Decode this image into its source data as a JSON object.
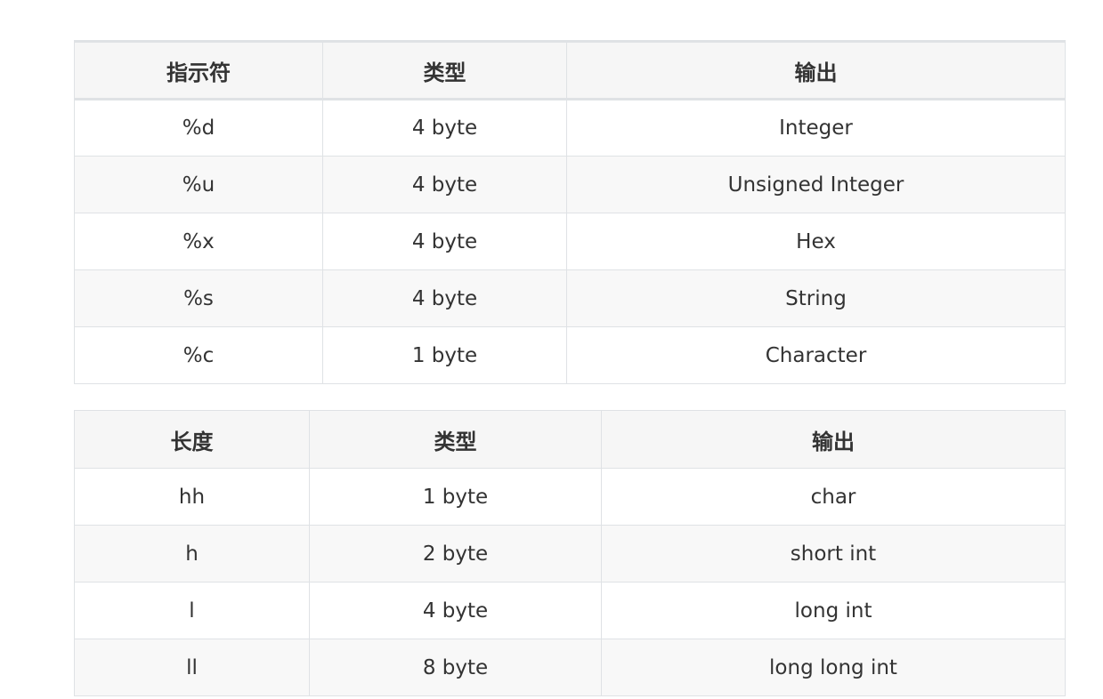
{
  "format_table": {
    "headers": [
      "指示符",
      "类型",
      "输出"
    ],
    "rows": [
      [
        "%d",
        "4 byte",
        "Integer"
      ],
      [
        "%u",
        "4 byte",
        "Unsigned Integer"
      ],
      [
        "%x",
        "4 byte",
        "Hex"
      ],
      [
        "%s",
        "4 byte",
        "String"
      ],
      [
        "%c",
        "1 byte",
        "Character"
      ]
    ]
  },
  "length_table": {
    "headers": [
      "长度",
      "类型",
      "输出"
    ],
    "rows": [
      [
        "hh",
        "1 byte",
        "char"
      ],
      [
        "h",
        "2 byte",
        "short int"
      ],
      [
        "l",
        "4 byte",
        "long int"
      ],
      [
        "ll",
        "8 byte",
        "long long int"
      ]
    ]
  }
}
